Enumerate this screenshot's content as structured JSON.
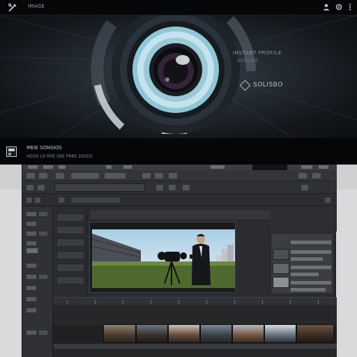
{
  "app": {
    "title": "IMAGE",
    "logo_icon": "tools-icon",
    "right_icons": [
      "user-icon",
      "gear-icon",
      "dots-icon"
    ]
  },
  "hero": {
    "brand": "INSTANT PROFILE",
    "brand_sub": "WEBCAM",
    "cta_label": "SOLISBO",
    "cta_icon": "diamond-icon",
    "accent_color": "#8fc6d6"
  },
  "strip": {
    "title": "MEIE SONSIOS",
    "subtitle": "HESIS LR RRE SRE PRRE DIDEIS",
    "icon": "film-icon"
  },
  "editor": {
    "background_color": "#2a2c2f",
    "viewer_icon": "video-preview",
    "timeline_icon": "timeline",
    "clip_count": 7
  }
}
